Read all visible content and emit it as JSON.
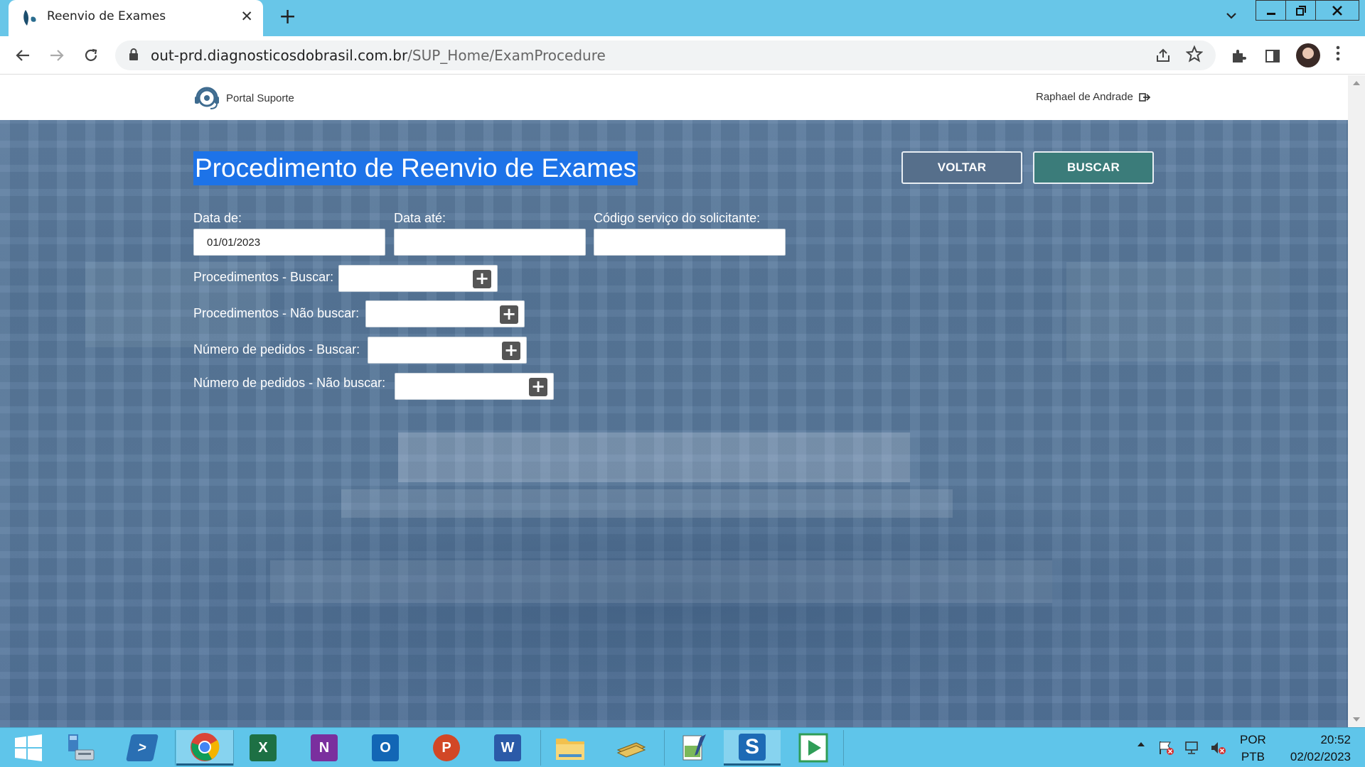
{
  "browser": {
    "tab_title": "Reenvio de Exames",
    "tab_close": "✕",
    "new_tab": "+",
    "url_host": "out-prd.diagnosticosdobrasil.com.br",
    "url_path": "/SUP_Home/ExamProcedure"
  },
  "header": {
    "brand": "Portal Suporte",
    "user_name": "Raphael de Andrade"
  },
  "main": {
    "title": "Procedimento de Reenvio de Exames",
    "back_label": "VOLTAR",
    "search_label": "BUSCAR",
    "date_from_label": "Data de:",
    "date_from_value": "01/01/2023",
    "date_to_label": "Data até:",
    "date_to_value": "",
    "service_code_label": "Código serviço do solicitante:",
    "service_code_value": "",
    "proc_include_label": "Procedimentos - Buscar:",
    "proc_exclude_label": "Procedimentos - Não buscar:",
    "order_include_label": "Número de pedidos - Buscar:",
    "order_exclude_label": "Número de pedidos - Não buscar:"
  },
  "taskbar": {
    "lang_top": "POR",
    "lang_bottom": "PTB",
    "time": "20:52",
    "date": "02/02/2023"
  },
  "colors": {
    "tabbar": "#68c6e8",
    "hero": "#5b7c9f",
    "title_highlight": "#1d73e8",
    "buscar_button": "#3b7c7a",
    "voltar_button": "#566f8b",
    "taskbar": "#5fc5ea"
  }
}
